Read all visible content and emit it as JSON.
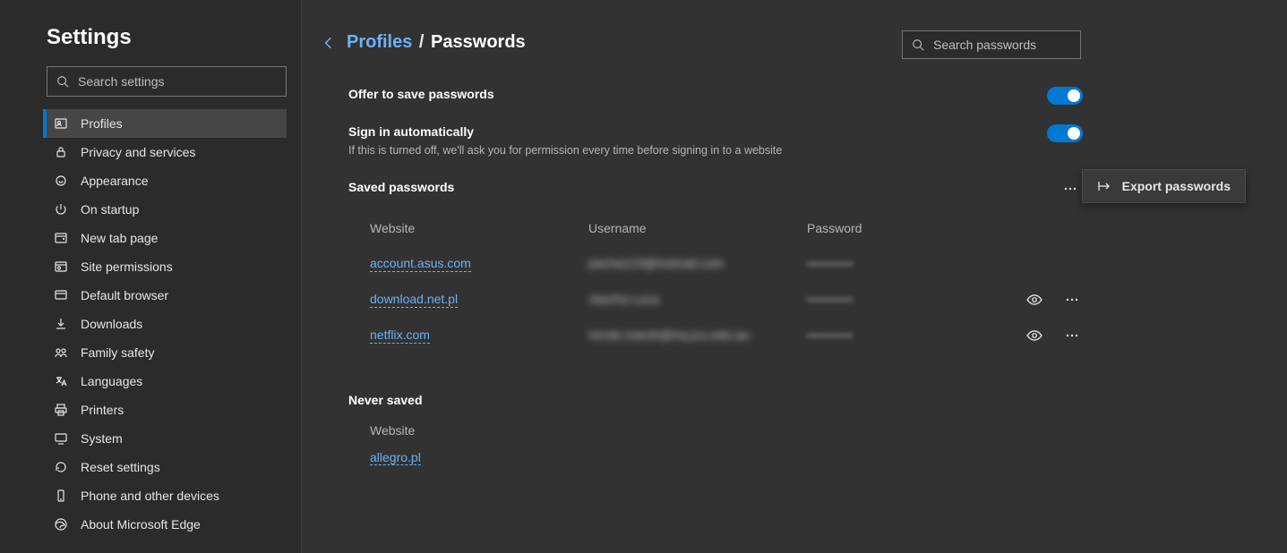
{
  "sidebar": {
    "title": "Settings",
    "search_placeholder": "Search settings",
    "items": [
      {
        "label": "Profiles"
      },
      {
        "label": "Privacy and services"
      },
      {
        "label": "Appearance"
      },
      {
        "label": "On startup"
      },
      {
        "label": "New tab page"
      },
      {
        "label": "Site permissions"
      },
      {
        "label": "Default browser"
      },
      {
        "label": "Downloads"
      },
      {
        "label": "Family safety"
      },
      {
        "label": "Languages"
      },
      {
        "label": "Printers"
      },
      {
        "label": "System"
      },
      {
        "label": "Reset settings"
      },
      {
        "label": "Phone and other devices"
      },
      {
        "label": "About Microsoft Edge"
      }
    ]
  },
  "breadcrumb": {
    "parent": "Profiles",
    "separator": "/",
    "current": "Passwords"
  },
  "search_passwords_placeholder": "Search passwords",
  "settings": {
    "offer_title": "Offer to save passwords",
    "signin_title": "Sign in automatically",
    "signin_desc": "If this is turned off, we'll ask you for permission every time before signing in to a website"
  },
  "saved": {
    "heading": "Saved passwords",
    "columns": {
      "website": "Website",
      "username": "Username",
      "password": "Password"
    },
    "rows": [
      {
        "site": "account.asus.com",
        "user": "pacha123@hotmail.com",
        "pass": "••••••••••"
      },
      {
        "site": "download.net.pl",
        "user": "Jascha Luca",
        "pass": "••••••••••"
      },
      {
        "site": "netflix.com",
        "user": "nicole.marsh@my.jcu.edu.au",
        "pass": "••••••••••"
      }
    ]
  },
  "export_label": "Export passwords",
  "never": {
    "heading": "Never saved",
    "column": "Website",
    "rows": [
      {
        "site": "allegro.pl"
      }
    ]
  }
}
